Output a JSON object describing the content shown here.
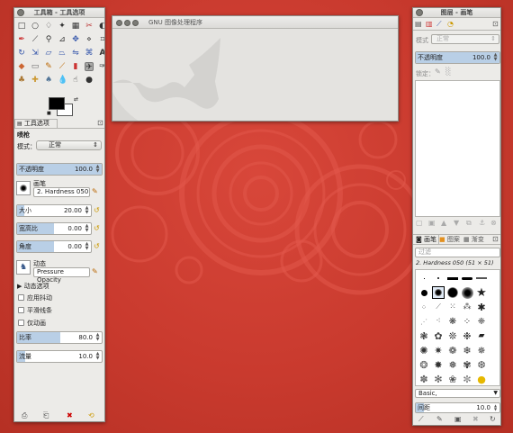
{
  "desktop": {
    "background": "#c9382c"
  },
  "toolbox": {
    "title": "工具箱 - 工具选项",
    "tool_options_tab": "工具选项",
    "tool_name": "喷枪",
    "mode_label": "模式：",
    "mode_value": "正常",
    "opacity_label": "不透明度",
    "opacity_value": "100.0",
    "brush_label": "画笔",
    "brush_value": "2. Hardness 050",
    "size_label": "大小",
    "size_value": "20.00",
    "aspect_label": "宽高比",
    "aspect_value": "0.00",
    "angle_label": "角度",
    "angle_value": "0.00",
    "dynamics_label": "动态",
    "dynamics_value": "Pressure Opacity",
    "dynamics_options": "动态选项",
    "apply_jitter": "应用抖动",
    "smooth_stroke": "平滑线条",
    "incremental": "仅动画",
    "rate_label": "比率",
    "rate_value": "80.0",
    "rate_level": 0.8,
    "flow_label": "流量",
    "flow_value": "10.0",
    "flow_level": 0.1
  },
  "image_window": {
    "title": "GNU 图像处理程序"
  },
  "layers": {
    "title": "图层 - 画笔",
    "mode_label": "模式",
    "mode_value": "正常",
    "opacity_label": "不透明度",
    "opacity_value": "100.0",
    "lock_label": "锁定："
  },
  "brushes": {
    "tab_brushes": "画笔",
    "tab_patterns": "图案",
    "tab_gradients": "渐变",
    "filter_placeholder": "过滤",
    "brush_name": "2. Hardness 050 (51 × 51)",
    "tag_value": "Basic,",
    "spacing_label": "间距",
    "spacing_value": "10.0"
  }
}
